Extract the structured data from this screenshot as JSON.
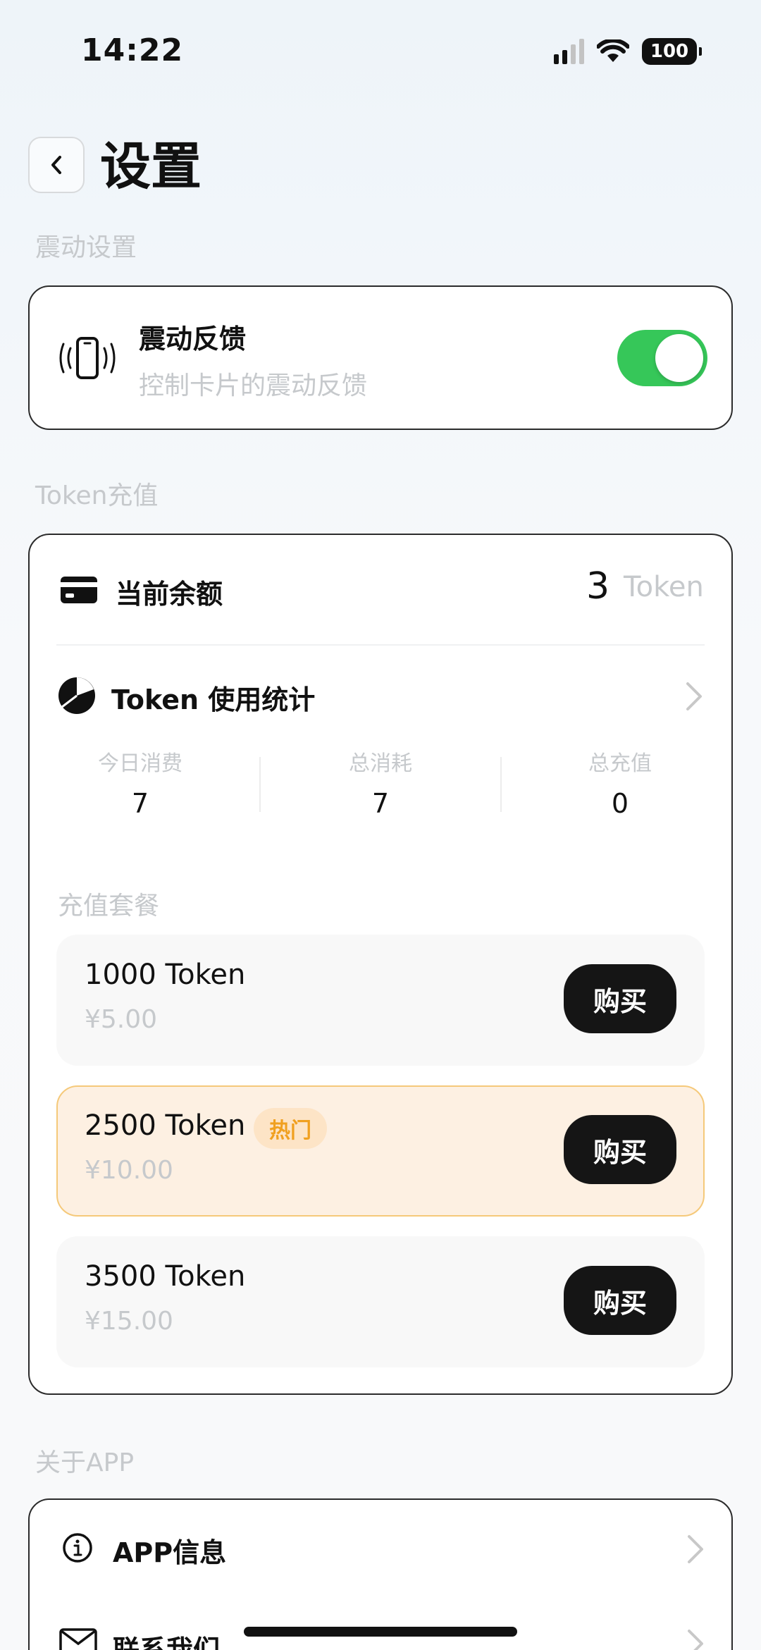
{
  "status_bar": {
    "time": "14:22",
    "battery": "100"
  },
  "header": {
    "title": "设置"
  },
  "vibration": {
    "section_title": "震动设置",
    "title": "震动反馈",
    "subtitle": "控制卡片的震动反馈",
    "enabled": true
  },
  "token": {
    "section_title": "Token充值",
    "balance_label": "当前余额",
    "balance_value": "3",
    "balance_unit": "Token",
    "stats_title": "Token 使用统计",
    "stats": [
      {
        "label": "今日消费",
        "value": "7"
      },
      {
        "label": "总消耗",
        "value": "7"
      },
      {
        "label": "总充值",
        "value": "0"
      }
    ],
    "packages_title": "充值套餐",
    "packages": [
      {
        "name": "1000 Token",
        "price": "¥5.00",
        "buy": "购买"
      },
      {
        "name": "2500 Token",
        "price": "¥10.00",
        "buy": "购买",
        "badge": "热门"
      },
      {
        "name": "3500 Token",
        "price": "¥15.00",
        "buy": "购买"
      }
    ]
  },
  "about": {
    "section_title": "关于APP",
    "items": [
      {
        "label": "APP信息",
        "icon": "info-icon"
      },
      {
        "label": "联系我们",
        "icon": "mail-icon"
      }
    ]
  },
  "colors": {
    "accent_green": "#36c759",
    "hot_orange": "#f0a020",
    "button_dark": "#151515"
  }
}
